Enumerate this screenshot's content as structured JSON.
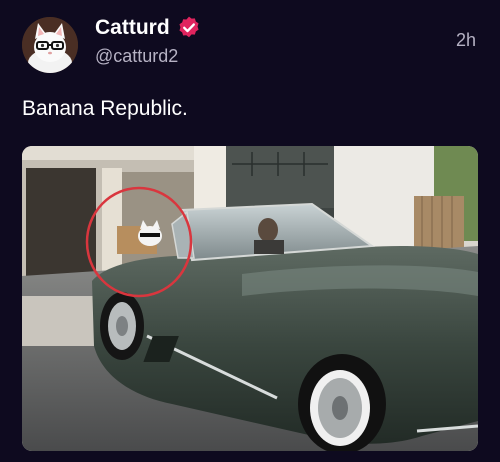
{
  "tweet": {
    "author_name": "Catturd",
    "handle": "@catturd2",
    "timestamp": "2h",
    "text": "Banana Republic.",
    "verified": true,
    "verified_badge_color": "#e0245e",
    "avatar_icon": "white-cat-with-glasses-avatar",
    "media_description_icon": "photo"
  },
  "colors": {
    "background": "#0e0a1f",
    "text_primary": "#ffffff",
    "text_secondary": "#b6b2c4",
    "highlight_circle": "#d9363e"
  }
}
